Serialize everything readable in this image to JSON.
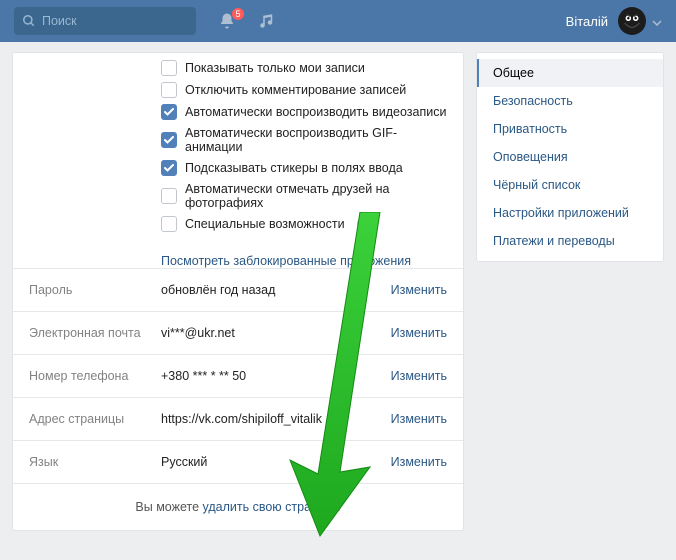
{
  "topbar": {
    "search_placeholder": "Поиск",
    "notification_count": "5",
    "username": "Віталій"
  },
  "checkboxes": [
    {
      "label": "Показывать только мои записи",
      "checked": false
    },
    {
      "label": "Отключить комментирование записей",
      "checked": false
    },
    {
      "label": "Автоматически воспроизводить видеозаписи",
      "checked": true
    },
    {
      "label": "Автоматически воспроизводить GIF-анимации",
      "checked": true
    },
    {
      "label": "Подсказывать стикеры в полях ввода",
      "checked": true
    },
    {
      "label": "Автоматически отмечать друзей на фотографиях",
      "checked": false
    },
    {
      "label": "Специальные возможности",
      "checked": false,
      "help": true
    }
  ],
  "blocked_apps_link": "Посмотреть заблокированные приложения",
  "settings": [
    {
      "label": "Пароль",
      "value": "обновлён год назад",
      "action": "Изменить"
    },
    {
      "label": "Электронная почта",
      "value": "vi***@ukr.net",
      "action": "Изменить"
    },
    {
      "label": "Номер телефона",
      "value": "+380 *** * ** 50",
      "action": "Изменить"
    },
    {
      "label": "Адрес страницы",
      "value": "https://vk.com/shipiloff_vitalik",
      "action": "Изменить"
    },
    {
      "label": "Язык",
      "value": "Русский",
      "action": "Изменить"
    }
  ],
  "footer": {
    "prefix": "Вы можете ",
    "link": "удалить свою страницу",
    "suffix": "."
  },
  "sidebar": {
    "items": [
      {
        "label": "Общее",
        "active": true
      },
      {
        "label": "Безопасность"
      },
      {
        "label": "Приватность"
      },
      {
        "label": "Оповещения"
      },
      {
        "label": "Чёрный список"
      },
      {
        "label": "Настройки приложений"
      },
      {
        "label": "Платежи и переводы"
      }
    ]
  }
}
